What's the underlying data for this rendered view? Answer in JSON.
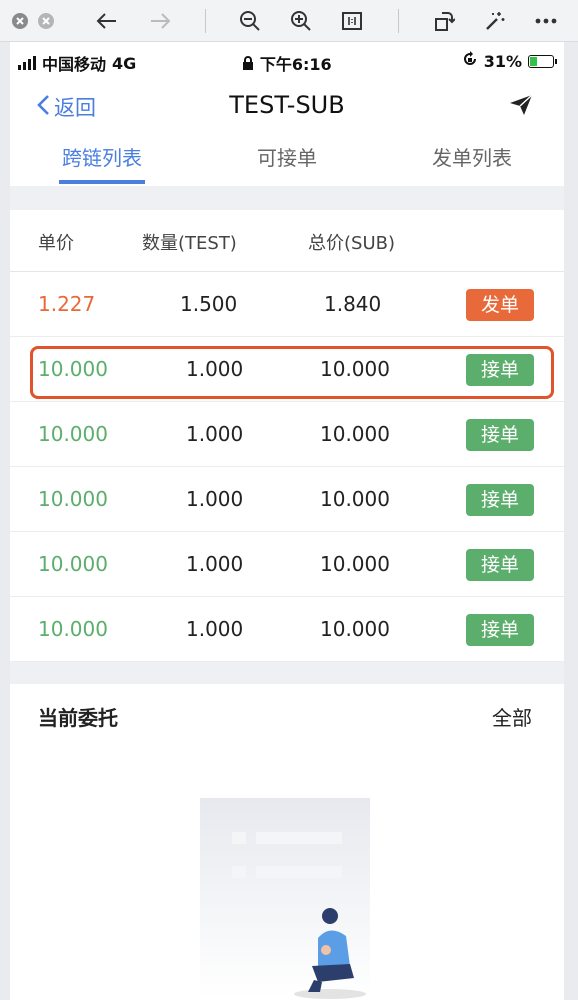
{
  "status_bar": {
    "carrier": "中国移动",
    "network": "4G",
    "time": "下午6:16",
    "battery": "31%",
    "battery_level": 0.31
  },
  "nav": {
    "back_label": "返回",
    "title": "TEST-SUB"
  },
  "tabs": [
    {
      "label": "跨链列表",
      "active": true
    },
    {
      "label": "可接单",
      "active": false
    },
    {
      "label": "发单列表",
      "active": false
    }
  ],
  "table": {
    "headers": [
      "单价",
      "数量(TEST)",
      "总价(SUB)"
    ],
    "rows": [
      {
        "price": "1.227",
        "qty": "1.500",
        "total": "1.840",
        "action": "发单",
        "type": "sell"
      },
      {
        "price": "10.000",
        "qty": "1.000",
        "total": "10.000",
        "action": "接单",
        "type": "take"
      },
      {
        "price": "10.000",
        "qty": "1.000",
        "total": "10.000",
        "action": "接单",
        "type": "take"
      },
      {
        "price": "10.000",
        "qty": "1.000",
        "total": "10.000",
        "action": "接单",
        "type": "take"
      },
      {
        "price": "10.000",
        "qty": "1.000",
        "total": "10.000",
        "action": "接单",
        "type": "take"
      },
      {
        "price": "10.000",
        "qty": "1.000",
        "total": "10.000",
        "action": "接单",
        "type": "take"
      }
    ]
  },
  "entrust": {
    "title": "当前委托",
    "all_label": "全部"
  },
  "colors": {
    "accent": "#4a7ee0",
    "sell": "#e8693a",
    "take": "#5cae6c",
    "take_text": "#5cae6c",
    "highlight": "#e0532b"
  },
  "icons": {
    "viewer": [
      "close-circle-icon",
      "close-circle-icon",
      "arrow-left-icon",
      "arrow-right-icon",
      "zoom-out-icon",
      "zoom-in-icon",
      "actual-size-icon",
      "rotate-icon",
      "magic-wand-icon",
      "more-icon"
    ],
    "nav_right": "send-icon"
  }
}
